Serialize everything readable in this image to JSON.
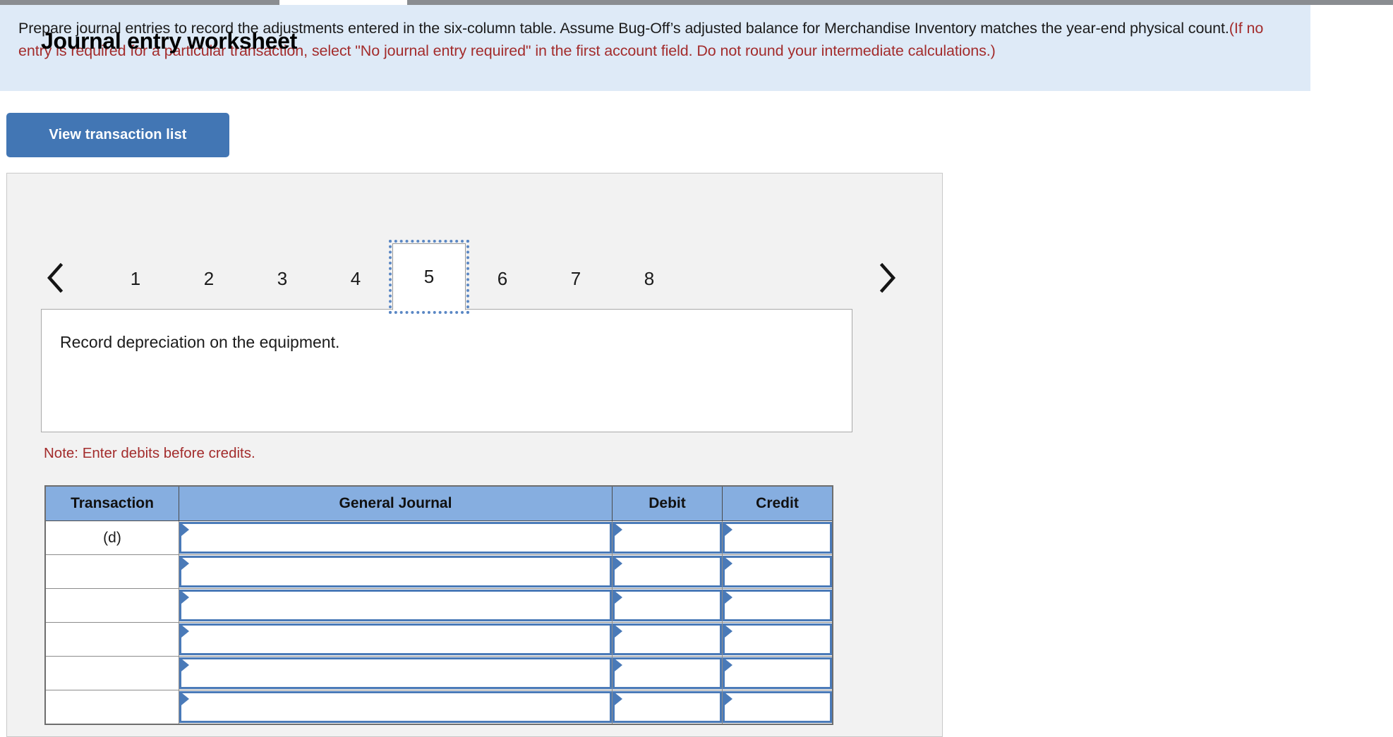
{
  "banner": {
    "text_main_1": "Prepare journal entries to record the adjustments entered in the six-column table. Assume Bug-Off’s adjusted balance for Merchandise Inventory matches the year-end physical count.",
    "text_paren": "(If no entry is required for a particular transaction, select \"No journal entry required\" in the first account field. Do not round your intermediate calculations.)",
    "paren_color": "#a32c2c",
    "background_color": "#deeaf7"
  },
  "toolbar": {
    "view_transaction_list_label": "View transaction list",
    "button_color": "#4276b4"
  },
  "worksheet": {
    "title": "Journal entry worksheet",
    "prev_icon": "chevron-left-icon",
    "next_icon": "chevron-right-icon",
    "tabs": [
      {
        "label": "1",
        "active": false
      },
      {
        "label": "2",
        "active": false
      },
      {
        "label": "3",
        "active": false
      },
      {
        "label": "4",
        "active": false
      },
      {
        "label": "5",
        "active": true
      },
      {
        "label": "6",
        "active": false
      },
      {
        "label": "7",
        "active": false
      },
      {
        "label": "8",
        "active": false
      }
    ],
    "active_tab": "5",
    "description": "Record depreciation on the equipment.",
    "note": "Note: Enter debits before credits.",
    "note_color": "#a32c2c"
  },
  "journal_table": {
    "headers": [
      "Transaction",
      "General Journal",
      "Debit",
      "Credit"
    ],
    "header_color": "#86aee0",
    "input_border_color": "#4a7ab8",
    "rows": [
      {
        "transaction": "(d)",
        "general_journal": "",
        "debit": "",
        "credit": ""
      },
      {
        "transaction": "",
        "general_journal": "",
        "debit": "",
        "credit": ""
      },
      {
        "transaction": "",
        "general_journal": "",
        "debit": "",
        "credit": ""
      },
      {
        "transaction": "",
        "general_journal": "",
        "debit": "",
        "credit": ""
      },
      {
        "transaction": "",
        "general_journal": "",
        "debit": "",
        "credit": ""
      },
      {
        "transaction": "",
        "general_journal": "",
        "debit": "",
        "credit": ""
      }
    ]
  }
}
